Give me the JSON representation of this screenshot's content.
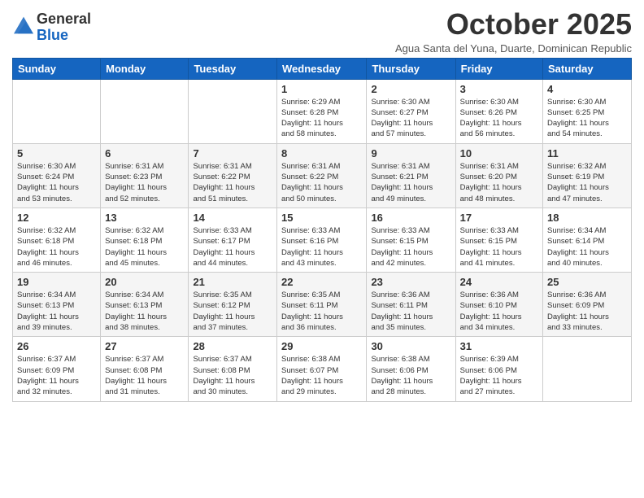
{
  "logo": {
    "general": "General",
    "blue": "Blue"
  },
  "title": "October 2025",
  "subtitle": "Agua Santa del Yuna, Duarte, Dominican Republic",
  "days_of_week": [
    "Sunday",
    "Monday",
    "Tuesday",
    "Wednesday",
    "Thursday",
    "Friday",
    "Saturday"
  ],
  "weeks": [
    [
      {
        "day": "",
        "info": ""
      },
      {
        "day": "",
        "info": ""
      },
      {
        "day": "",
        "info": ""
      },
      {
        "day": "1",
        "info": "Sunrise: 6:29 AM\nSunset: 6:28 PM\nDaylight: 11 hours\nand 58 minutes."
      },
      {
        "day": "2",
        "info": "Sunrise: 6:30 AM\nSunset: 6:27 PM\nDaylight: 11 hours\nand 57 minutes."
      },
      {
        "day": "3",
        "info": "Sunrise: 6:30 AM\nSunset: 6:26 PM\nDaylight: 11 hours\nand 56 minutes."
      },
      {
        "day": "4",
        "info": "Sunrise: 6:30 AM\nSunset: 6:25 PM\nDaylight: 11 hours\nand 54 minutes."
      }
    ],
    [
      {
        "day": "5",
        "info": "Sunrise: 6:30 AM\nSunset: 6:24 PM\nDaylight: 11 hours\nand 53 minutes."
      },
      {
        "day": "6",
        "info": "Sunrise: 6:31 AM\nSunset: 6:23 PM\nDaylight: 11 hours\nand 52 minutes."
      },
      {
        "day": "7",
        "info": "Sunrise: 6:31 AM\nSunset: 6:22 PM\nDaylight: 11 hours\nand 51 minutes."
      },
      {
        "day": "8",
        "info": "Sunrise: 6:31 AM\nSunset: 6:22 PM\nDaylight: 11 hours\nand 50 minutes."
      },
      {
        "day": "9",
        "info": "Sunrise: 6:31 AM\nSunset: 6:21 PM\nDaylight: 11 hours\nand 49 minutes."
      },
      {
        "day": "10",
        "info": "Sunrise: 6:31 AM\nSunset: 6:20 PM\nDaylight: 11 hours\nand 48 minutes."
      },
      {
        "day": "11",
        "info": "Sunrise: 6:32 AM\nSunset: 6:19 PM\nDaylight: 11 hours\nand 47 minutes."
      }
    ],
    [
      {
        "day": "12",
        "info": "Sunrise: 6:32 AM\nSunset: 6:18 PM\nDaylight: 11 hours\nand 46 minutes."
      },
      {
        "day": "13",
        "info": "Sunrise: 6:32 AM\nSunset: 6:18 PM\nDaylight: 11 hours\nand 45 minutes."
      },
      {
        "day": "14",
        "info": "Sunrise: 6:33 AM\nSunset: 6:17 PM\nDaylight: 11 hours\nand 44 minutes."
      },
      {
        "day": "15",
        "info": "Sunrise: 6:33 AM\nSunset: 6:16 PM\nDaylight: 11 hours\nand 43 minutes."
      },
      {
        "day": "16",
        "info": "Sunrise: 6:33 AM\nSunset: 6:15 PM\nDaylight: 11 hours\nand 42 minutes."
      },
      {
        "day": "17",
        "info": "Sunrise: 6:33 AM\nSunset: 6:15 PM\nDaylight: 11 hours\nand 41 minutes."
      },
      {
        "day": "18",
        "info": "Sunrise: 6:34 AM\nSunset: 6:14 PM\nDaylight: 11 hours\nand 40 minutes."
      }
    ],
    [
      {
        "day": "19",
        "info": "Sunrise: 6:34 AM\nSunset: 6:13 PM\nDaylight: 11 hours\nand 39 minutes."
      },
      {
        "day": "20",
        "info": "Sunrise: 6:34 AM\nSunset: 6:13 PM\nDaylight: 11 hours\nand 38 minutes."
      },
      {
        "day": "21",
        "info": "Sunrise: 6:35 AM\nSunset: 6:12 PM\nDaylight: 11 hours\nand 37 minutes."
      },
      {
        "day": "22",
        "info": "Sunrise: 6:35 AM\nSunset: 6:11 PM\nDaylight: 11 hours\nand 36 minutes."
      },
      {
        "day": "23",
        "info": "Sunrise: 6:36 AM\nSunset: 6:11 PM\nDaylight: 11 hours\nand 35 minutes."
      },
      {
        "day": "24",
        "info": "Sunrise: 6:36 AM\nSunset: 6:10 PM\nDaylight: 11 hours\nand 34 minutes."
      },
      {
        "day": "25",
        "info": "Sunrise: 6:36 AM\nSunset: 6:09 PM\nDaylight: 11 hours\nand 33 minutes."
      }
    ],
    [
      {
        "day": "26",
        "info": "Sunrise: 6:37 AM\nSunset: 6:09 PM\nDaylight: 11 hours\nand 32 minutes."
      },
      {
        "day": "27",
        "info": "Sunrise: 6:37 AM\nSunset: 6:08 PM\nDaylight: 11 hours\nand 31 minutes."
      },
      {
        "day": "28",
        "info": "Sunrise: 6:37 AM\nSunset: 6:08 PM\nDaylight: 11 hours\nand 30 minutes."
      },
      {
        "day": "29",
        "info": "Sunrise: 6:38 AM\nSunset: 6:07 PM\nDaylight: 11 hours\nand 29 minutes."
      },
      {
        "day": "30",
        "info": "Sunrise: 6:38 AM\nSunset: 6:06 PM\nDaylight: 11 hours\nand 28 minutes."
      },
      {
        "day": "31",
        "info": "Sunrise: 6:39 AM\nSunset: 6:06 PM\nDaylight: 11 hours\nand 27 minutes."
      },
      {
        "day": "",
        "info": ""
      }
    ]
  ]
}
